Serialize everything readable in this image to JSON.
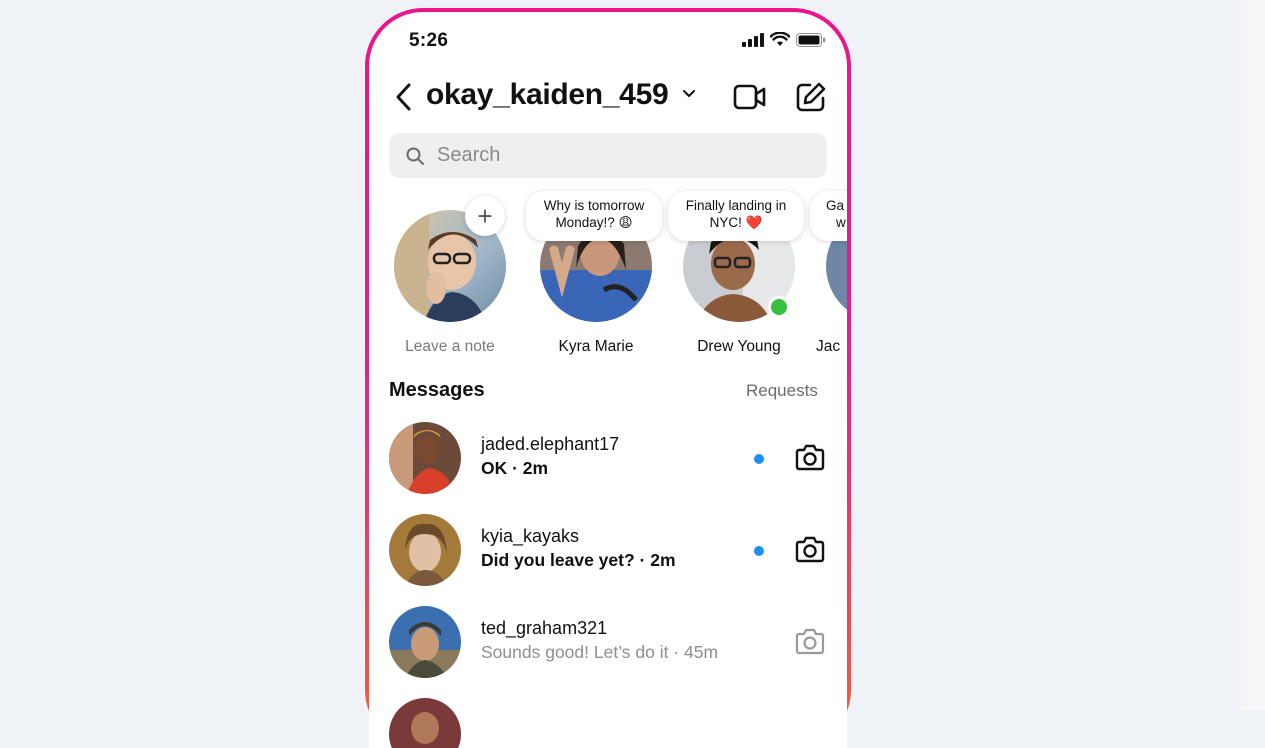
{
  "status_bar": {
    "time": "5:26"
  },
  "header": {
    "username": "okay_kaiden_459"
  },
  "search": {
    "placeholder": "Search"
  },
  "notes": [
    {
      "name": "Leave a note",
      "note": ""
    },
    {
      "name": "Kyra Marie",
      "note_line1": "Why is tomorrow",
      "note_line2": "Monday!? 😩"
    },
    {
      "name": "Drew Young",
      "note_line1": "Finally landing in",
      "note_line2": "NYC! ❤️"
    },
    {
      "name": "Jac",
      "note_line1": "Ga",
      "note_line2": "w"
    }
  ],
  "messages": {
    "title": "Messages",
    "requests_label": "Requests",
    "threads": [
      {
        "username": "jaded.elephant17",
        "preview": "OK · 2m",
        "unread": true
      },
      {
        "username": "kyia_kayaks",
        "preview": "Did you leave yet? · 2m",
        "unread": true
      },
      {
        "username": "ted_graham321",
        "preview": "Sounds good! Let’s do it · 45m",
        "unread": false
      }
    ]
  },
  "colors": {
    "accent_border": "#e8168a",
    "unread_dot": "#1d8ff0",
    "online_dot": "#37c03c",
    "page_background": "#eff2f6"
  }
}
